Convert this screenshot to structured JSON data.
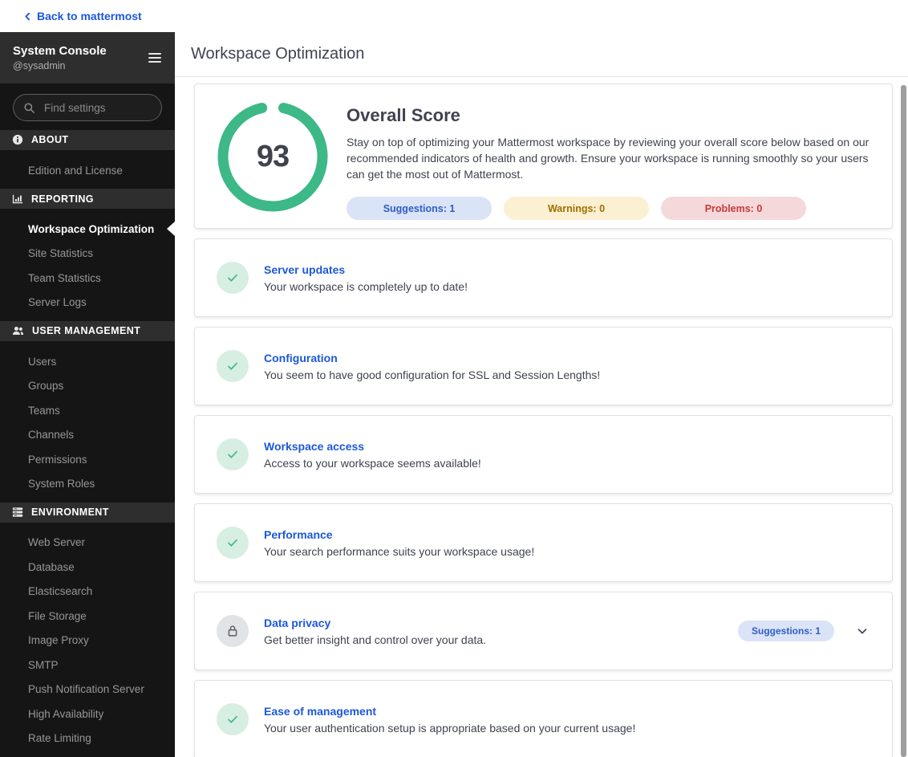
{
  "top_bar": {
    "back_link": "Back to mattermost"
  },
  "sidebar": {
    "title": "System Console",
    "subtitle": "@sysadmin",
    "search_placeholder": "Find settings",
    "sections": [
      {
        "label": "ABOUT",
        "icon": "info-icon",
        "items": [
          {
            "label": "Edition and License"
          }
        ]
      },
      {
        "label": "REPORTING",
        "icon": "bar-chart-icon",
        "items": [
          {
            "label": "Workspace Optimization",
            "active": true
          },
          {
            "label": "Site Statistics"
          },
          {
            "label": "Team Statistics"
          },
          {
            "label": "Server Logs"
          }
        ]
      },
      {
        "label": "USER MANAGEMENT",
        "icon": "users-icon",
        "items": [
          {
            "label": "Users"
          },
          {
            "label": "Groups"
          },
          {
            "label": "Teams"
          },
          {
            "label": "Channels"
          },
          {
            "label": "Permissions"
          },
          {
            "label": "System Roles"
          }
        ]
      },
      {
        "label": "ENVIRONMENT",
        "icon": "server-icon",
        "items": [
          {
            "label": "Web Server"
          },
          {
            "label": "Database"
          },
          {
            "label": "Elasticsearch"
          },
          {
            "label": "File Storage"
          },
          {
            "label": "Image Proxy"
          },
          {
            "label": "SMTP"
          },
          {
            "label": "Push Notification Server"
          },
          {
            "label": "High Availability"
          },
          {
            "label": "Rate Limiting"
          }
        ]
      }
    ]
  },
  "header": {
    "title": "Workspace Optimization"
  },
  "overview": {
    "score": "93",
    "title": "Overall Score",
    "description": "Stay on top of optimizing your Mattermost workspace by reviewing your overall score below based on our recommended indicators of health and growth. Ensure your workspace is running smoothly so your users can get the most out of Mattermost.",
    "chips": [
      {
        "label": "Suggestions: 1",
        "type": "info"
      },
      {
        "label": "Warnings: 0",
        "type": "warning"
      },
      {
        "label": "Problems: 0",
        "type": "error"
      }
    ]
  },
  "cards": [
    {
      "title": "Server updates",
      "description": "Your workspace is completely up to date!",
      "status": "success"
    },
    {
      "title": "Configuration",
      "description": "You seem to have good configuration for SSL and Session Lengths!",
      "status": "success"
    },
    {
      "title": "Workspace access",
      "description": "Access to your workspace seems available!",
      "status": "success"
    },
    {
      "title": "Performance",
      "description": "Your search performance suits your workspace usage!",
      "status": "success"
    },
    {
      "title": "Data privacy",
      "description": "Get better insight and control over your data.",
      "status": "locked",
      "chip": "Suggestions: 1",
      "expandable": true
    },
    {
      "title": "Ease of management",
      "description": "Your user authentication setup is appropriate based on your current usage!",
      "status": "success"
    }
  ],
  "colors": {
    "accent_blue": "#1c58d9",
    "success_green": "#3db887",
    "warning_text": "#9d6f00",
    "error_red": "#d24b4e",
    "sidebar_bg": "#151515",
    "sidebar_header_bg": "#2e2e2e"
  }
}
